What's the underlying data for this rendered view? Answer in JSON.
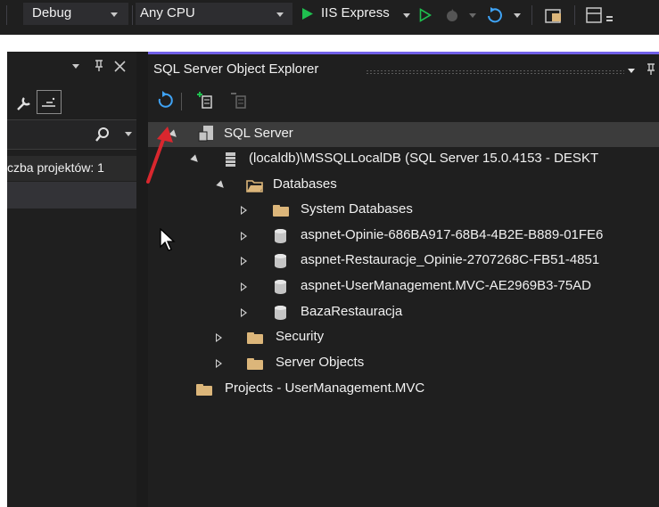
{
  "toolbar": {
    "config": "Debug",
    "platform": "Any CPU",
    "run_target": "IIS Express"
  },
  "left_panel": {
    "project_count_text": "czba projektów: 1"
  },
  "explorer": {
    "title": "SQL Server Object Explorer",
    "tree": {
      "root": "SQL Server",
      "instance": "(localdb)\\MSSQLLocalDB (SQL Server 15.0.4153 - DESKT",
      "databases": "Databases",
      "system_databases": "System Databases",
      "db1": "aspnet-Opinie-686BA917-68B4-4B2E-B889-01FE6",
      "db2": "aspnet-Restauracje_Opinie-2707268C-FB51-4851",
      "db3": "aspnet-UserManagement.MVC-AE2969B3-75AD",
      "db4": "BazaRestauracja",
      "security": "Security",
      "server_objects": "Server Objects",
      "projects": "Projects - UserManagement.MVC"
    }
  },
  "colors": {
    "background": "#1f1f1f",
    "accent": "#7160e8",
    "folder": "#dcb67a",
    "run_green": "#1fbf4f",
    "arrow_red": "#d9272e"
  }
}
